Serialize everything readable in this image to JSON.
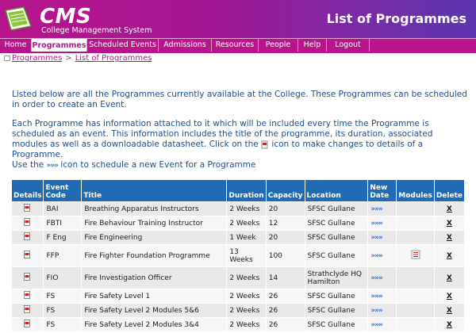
{
  "header": {
    "logo_title": "CMS",
    "logo_subtitle": "College Management System",
    "page_heading": "List of Programmes"
  },
  "nav": {
    "items": [
      {
        "label": "Home"
      },
      {
        "label": "Programmes",
        "active": true
      },
      {
        "label": "Scheduled Events"
      },
      {
        "label": "Admissions"
      },
      {
        "label": "Resources"
      },
      {
        "label": "People"
      },
      {
        "label": "Help"
      },
      {
        "label": "Logout"
      }
    ]
  },
  "breadcrumb": {
    "first": "Programmes",
    "separator": ">",
    "second": "List of Programmes"
  },
  "intro": {
    "p1": "Listed below are all the Programmes currently available at the College. These Programmes can be scheduled in order to create an Event.",
    "p2_before": "Each Programme has information attached to it which will be included every time the Programme is scheduled as an event. This information includes the title of the programme, its duration, associated modules as well as a downloadable datasheet. Click on the",
    "p2_after": "icon to make changes to details of a Programme.",
    "p3_before": "Use the",
    "p3_after": "icon to schedule a new Event for a Programme"
  },
  "table": {
    "headers": {
      "details": "Details",
      "code": "Event Code",
      "title": "Title",
      "duration": "Duration",
      "capacity": "Capacity",
      "location": "Location",
      "new_date": "New Date",
      "modules": "Modules",
      "delete": "Delete"
    },
    "schedule_glyph": "»»»",
    "delete_label": "X",
    "rows": [
      {
        "code": "BAI",
        "title": "Breathing Apparatus Instructors",
        "duration": "2 Weeks",
        "capacity": "20",
        "location": "SFSC Gullane",
        "modules": false
      },
      {
        "code": "FBTI",
        "title": "Fire Behaviour Training Instructor",
        "duration": "2 Weeks",
        "capacity": "12",
        "location": "SFSC Gullane",
        "modules": false
      },
      {
        "code": "F Eng",
        "title": "Fire Engineering",
        "duration": "1 Week",
        "capacity": "20",
        "location": "SFSC Gullane",
        "modules": false
      },
      {
        "code": "FFP",
        "title": "Fire Fighter Foundation Programme",
        "duration": "13 Weeks",
        "capacity": "100",
        "location": "SFSC Gullane",
        "modules": true
      },
      {
        "code": "FIO",
        "title": "Fire Investigation Officer",
        "duration": "2 Weeks",
        "capacity": "14",
        "location": "Strathclyde HQ Hamilton",
        "modules": false
      },
      {
        "code": "FS",
        "title": "Fire Safety Level 1",
        "duration": "2 Weeks",
        "capacity": "26",
        "location": "SFSC Gullane",
        "modules": false
      },
      {
        "code": "FS",
        "title": "Fire Safety Level 2 Modules 5&6",
        "duration": "2 Weeks",
        "capacity": "26",
        "location": "SFSC Gullane",
        "modules": false
      },
      {
        "code": "FS",
        "title": "Fire Safety Level 2 Modules 3&4",
        "duration": "2 Weeks",
        "capacity": "26",
        "location": "SFSC Gullane",
        "modules": false
      }
    ]
  }
}
